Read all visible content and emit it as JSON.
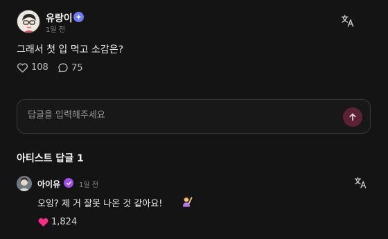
{
  "post": {
    "username": "유랑이",
    "time": "1일 전",
    "text": "그래서 첫 입 먹고 소감은?",
    "likes": "108",
    "comments": "75",
    "avatar_icon": "cartoon-avatar-icon",
    "verified_color": "#6a7cf5"
  },
  "reply_box": {
    "placeholder": "답글을 입력해주세요",
    "send_icon": "arrow-up-icon",
    "send_color": "#5b2134"
  },
  "artist_replies": {
    "title": "아티스트 답글 1",
    "items": [
      {
        "name": "아이유",
        "time": "1일 전",
        "text": "오잉? 제 거 잘못 나온 것 같아요!",
        "emoji_icon": "person-raising-hand-icon",
        "likes": "1,824",
        "verified_color": "#a24cf0",
        "heart_color": "#ff2d87"
      }
    ]
  }
}
